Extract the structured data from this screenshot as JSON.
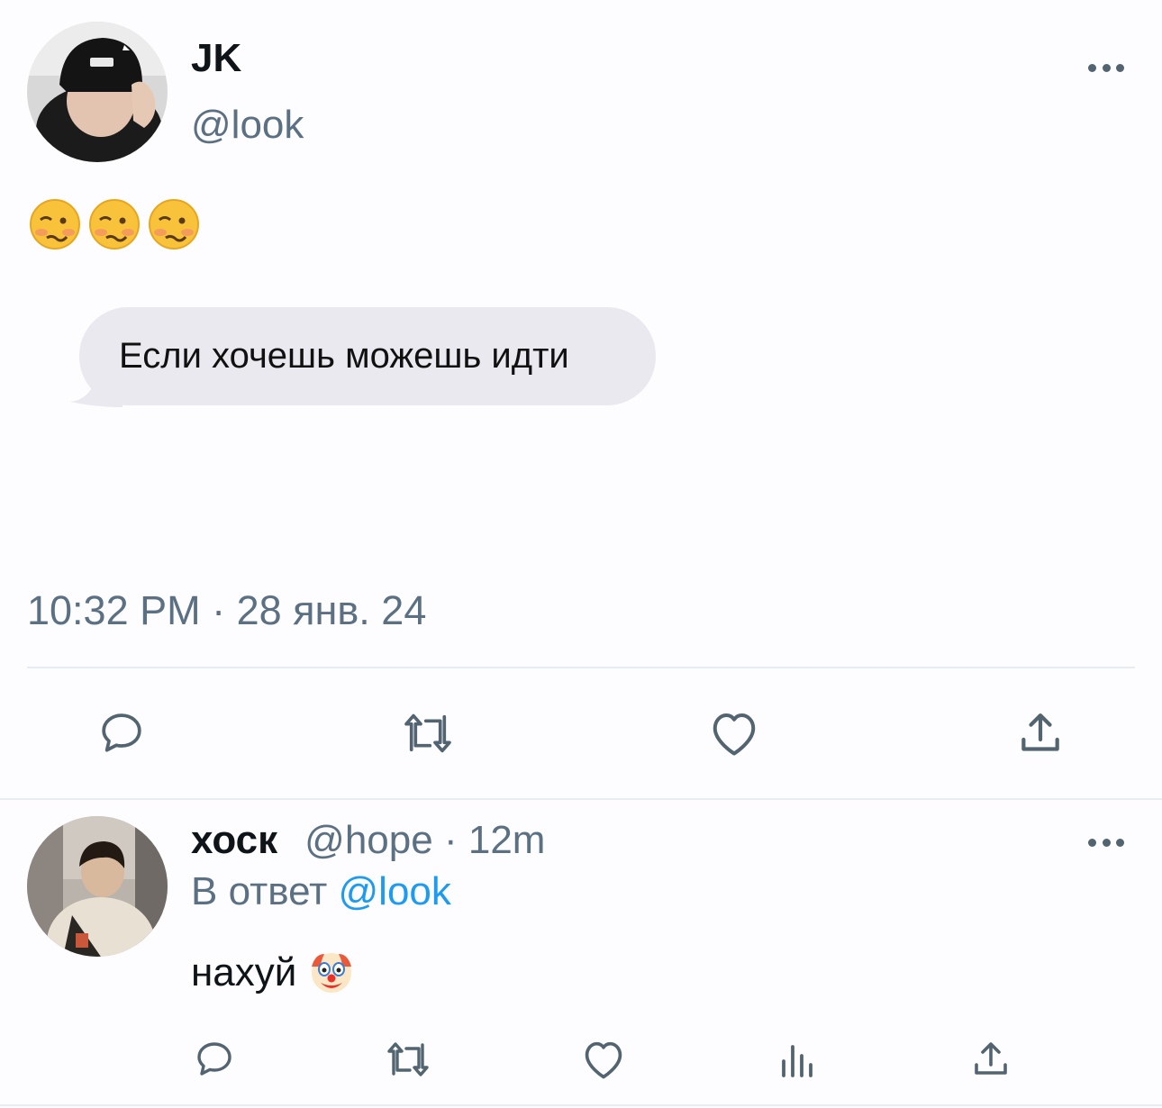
{
  "tweet": {
    "author_name": "JK",
    "author_handle": "@look",
    "emojis": [
      "woozy-face",
      "woozy-face",
      "woozy-face"
    ],
    "bubble_text": "Если хочешь можешь идти",
    "timestamp": "10:32 PM · 28 янв. 24",
    "actions": [
      "reply-icon",
      "retweet-icon",
      "like-icon",
      "share-icon"
    ]
  },
  "reply": {
    "author_name": "хоск",
    "author_handle": "@hope",
    "separator": " · ",
    "time": "12m",
    "reply_prefix": "В ответ ",
    "reply_to": "@look",
    "text": "нахуй",
    "emoji": "clown-face",
    "actions": [
      "reply-icon",
      "retweet-icon",
      "like-icon",
      "views-icon",
      "share-icon"
    ]
  },
  "colors": {
    "background": "#fdfcfe",
    "text": "#0f1419",
    "muted": "#5b7083",
    "link": "#1d9bf0",
    "bubble": "#e9e9ef",
    "divider": "#e6ecf0"
  }
}
